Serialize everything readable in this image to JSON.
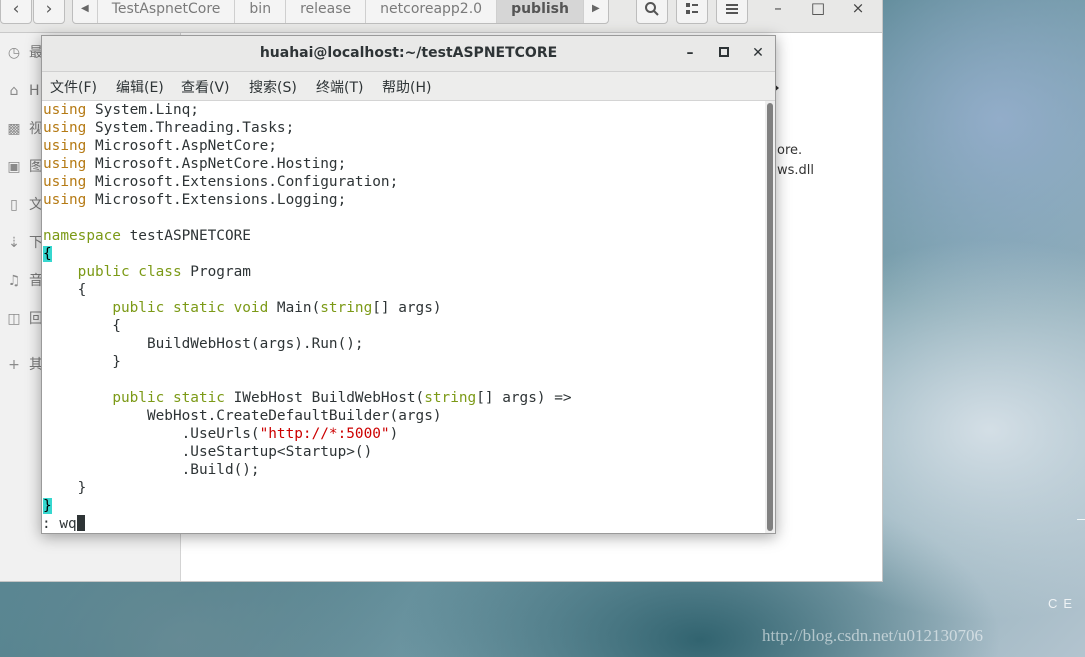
{
  "file_manager": {
    "breadcrumbs": [
      "TestAspnetCore",
      "bin",
      "release",
      "netcoreapp2.0",
      "publish"
    ],
    "sidebar": [
      {
        "icon": "clock-icon",
        "label": "最"
      },
      {
        "icon": "home-icon",
        "label": "H"
      },
      {
        "icon": "video-icon",
        "label": "视"
      },
      {
        "icon": "camera-icon",
        "label": "图"
      },
      {
        "icon": "document-icon",
        "label": "文"
      },
      {
        "icon": "download-icon",
        "label": "下"
      },
      {
        "icon": "music-icon",
        "label": "音"
      },
      {
        "icon": "trash-icon",
        "label": "回"
      },
      {
        "icon": "plus-icon",
        "label": "其"
      }
    ],
    "visible_file_fragments": [
      "ore.",
      "ws.dll"
    ]
  },
  "terminal": {
    "title": "huahai@localhost:~/testASPNETCORE",
    "menu": [
      "文件(F)",
      "编辑(E)",
      "查看(V)",
      "搜索(S)",
      "终端(T)",
      "帮助(H)"
    ],
    "status_command": ": wq"
  },
  "desktop": {
    "brand_text": "CE",
    "watermark": "http://blog.csdn.net/u012130706"
  },
  "colors": {
    "keyword_modifier": "#7c9a17",
    "keyword_using": "#b57a14",
    "string": "#cc0000",
    "brace_highlight": "#36d7cf"
  }
}
